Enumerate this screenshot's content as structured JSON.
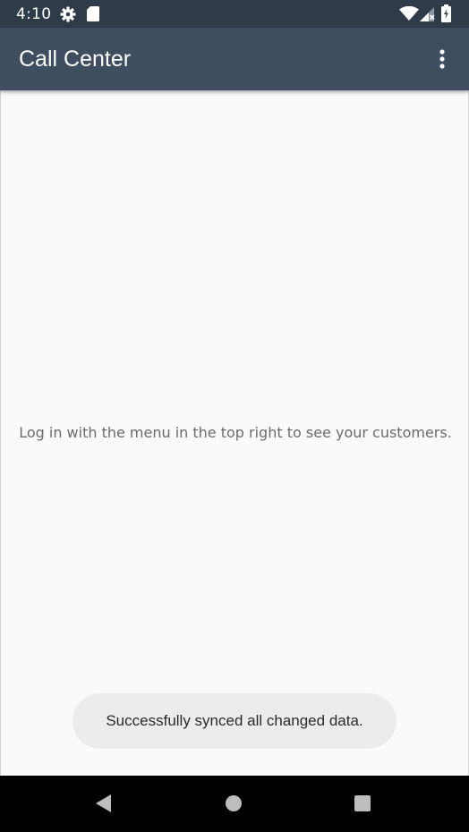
{
  "status_bar": {
    "time": "4:10",
    "icons": [
      "gear-icon",
      "sd-card-icon",
      "wifi-icon",
      "cell-signal-icon",
      "battery-icon"
    ]
  },
  "app_bar": {
    "title": "Call Center",
    "overflow_icon": "more-vert-icon"
  },
  "content": {
    "empty_message": "Log in with the menu in the top right to see your customers."
  },
  "toast": {
    "message": "Successfully synced all changed data."
  },
  "nav_bar": {
    "icons": [
      "back-icon",
      "home-icon",
      "recents-icon"
    ]
  },
  "colors": {
    "status_bar": "#2f3b49",
    "app_bar": "#3e4d60",
    "background": "#fafafa",
    "toast_background": "#ececec"
  }
}
